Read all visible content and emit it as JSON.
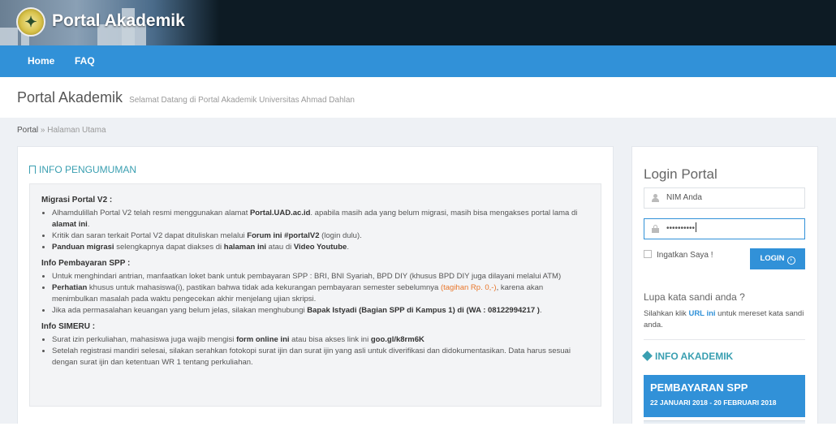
{
  "header": {
    "app_title": "Portal Akademik"
  },
  "nav": {
    "items": [
      "Home",
      "FAQ"
    ]
  },
  "page": {
    "title": "Portal Akademik",
    "subtitle": "Selamat Datang di Portal Akademik Universitas Ahmad Dahlan"
  },
  "breadcrumb": {
    "root": "Portal",
    "separator": "»",
    "current": "Halaman Utama"
  },
  "announcement": {
    "heading": "INFO PENGUMUMAN",
    "s1_title": "Migrasi Portal V2 :",
    "s1_i1_a": "Alhamdulillah Portal V2 telah resmi menggunakan alamat ",
    "s1_i1_b": "Portal.UAD.ac.id",
    "s1_i1_c": ". apabila masih ada yang belum migrasi, masih bisa mengakses portal lama di ",
    "s1_i1_d": "alamat ini",
    "s1_i1_e": ".",
    "s1_i2_a": "Kritik dan saran terkait Portal V2 dapat dituliskan melalui ",
    "s1_i2_b": "Forum ini #portalV2",
    "s1_i2_c": " (login dulu).",
    "s1_i3_a": "Panduan migrasi",
    "s1_i3_b": " selengkapnya dapat diakses di ",
    "s1_i3_c": "halaman ini",
    "s1_i3_d": " atau di ",
    "s1_i3_e": "Video Youtube",
    "s1_i3_f": ".",
    "s2_title": "Info Pembayaran SPP :",
    "s2_i1": "Untuk menghindari antrian, manfaatkan loket bank untuk pembayaran SPP : BRI, BNI Syariah, BPD DIY (khusus BPD DIY juga dilayani melalui ATM)",
    "s2_i2_a": "Perhatian",
    "s2_i2_b": " khusus untuk mahasiswa(i), pastikan bahwa tidak ada kekurangan pembayaran semester sebelumnya ",
    "s2_i2_c": "(tagihan Rp. 0,-)",
    "s2_i2_d": ", karena akan menimbulkan masalah pada waktu pengecekan akhir menjelang ujian skripsi.",
    "s2_i3_a": "Jika ada permasalahan keuangan yang belum jelas, silakan menghubungi ",
    "s2_i3_b": "Bapak Istyadi (Bagian SPP di Kampus 1) di (WA : 08122994217 )",
    "s2_i3_c": ".",
    "s3_title": "Info SIMERU :",
    "s3_i1_a": "Surat izin perkuliahan, mahasiswa juga wajib mengisi ",
    "s3_i1_b": "form online ini",
    "s3_i1_c": " atau bisa akses link ini ",
    "s3_i1_d": "goo.gl/k8rm6K",
    "s3_i2": "Setelah registrasi mandiri selesai, silakan serahkan fotokopi surat ijin dan surat ijin yang asli untuk diverifikasi dan didokumentasikan. Data harus sesuai dengan surat ijin dan ketentuan WR 1 tentang perkuliahan."
  },
  "login": {
    "title": "Login Portal",
    "nim_placeholder": "NIM Anda",
    "password_value": "••••••••••",
    "remember_label": "Ingatkan Saya !",
    "button_label": "LOGIN",
    "forgot_title": "Lupa kata sandi anda ?",
    "forgot_a": "Silahkan klik ",
    "forgot_link": "URL ini",
    "forgot_b": " untuk mereset kata sandi anda."
  },
  "info_akademik": {
    "heading": "INFO AKADEMIK",
    "card_title": "PEMBAYARAN SPP",
    "card_date": "22 JANUARI 2018 - 20 FEBRUARI 2018"
  },
  "colors": {
    "nav": "#3191d8",
    "accent": "#3a9fb1",
    "header": "#0d1b24",
    "warning": "#e8762a"
  },
  "icons": [
    "university-logo-icon",
    "bookmark-icon",
    "person-icon",
    "lock-icon",
    "arrow-right-circle-icon",
    "tag-icon"
  ]
}
